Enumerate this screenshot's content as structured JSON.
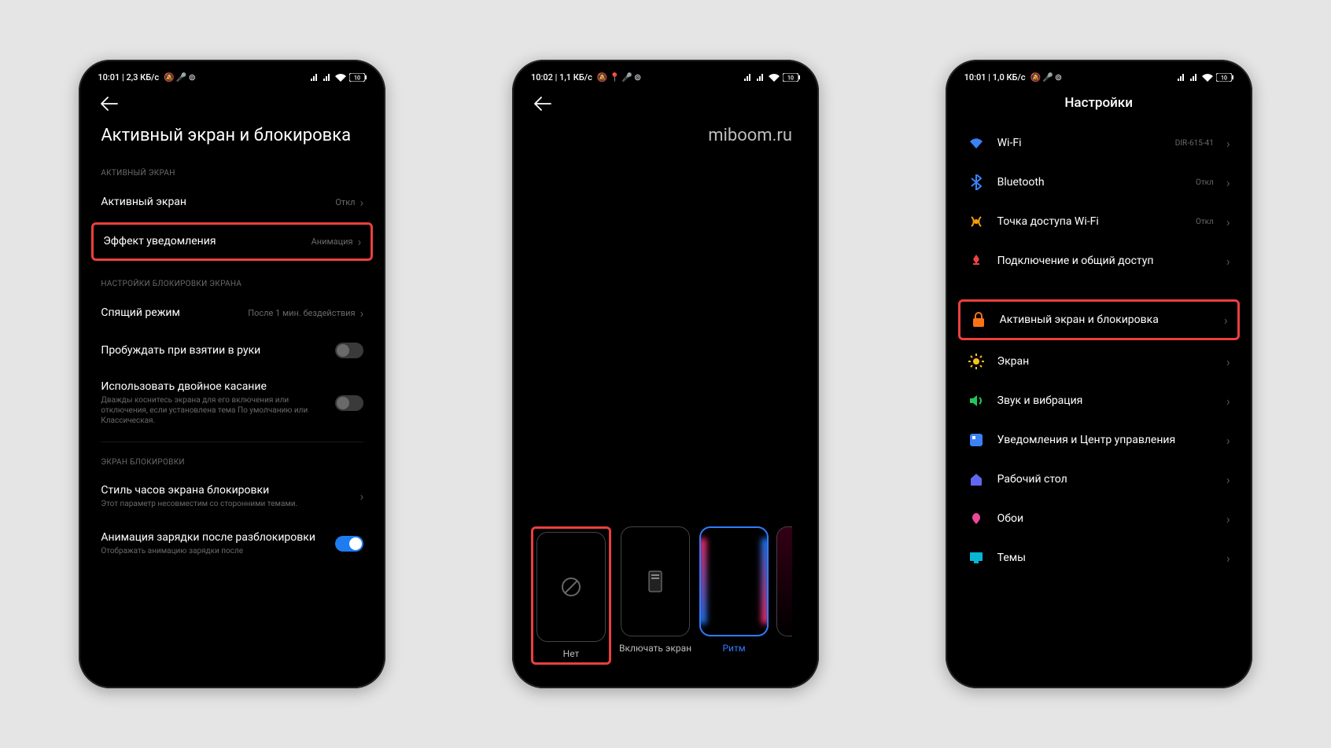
{
  "watermark": "miboom.ru",
  "phone1": {
    "status": {
      "left": "10:01 | 2,3 КБ/с"
    },
    "title": "Активный экран и блокировка",
    "section1": "АКТИВНЫЙ ЭКРАН",
    "row_active": {
      "label": "Активный экран",
      "value": "Откл"
    },
    "row_effect": {
      "label": "Эффект уведомления",
      "value": "Анимация"
    },
    "section2": "НАСТРОЙКИ БЛОКИРОВКИ ЭКРАНА",
    "row_sleep": {
      "label": "Спящий режим",
      "value": "После 1 мин. бездействия"
    },
    "row_raise": {
      "label": "Пробуждать при взятии в руки"
    },
    "row_doubletap": {
      "label": "Использовать двойное касание",
      "sub": "Дважды коснитесь экрана для его включения или отключения, если установлена тема По умолчанию или Классическая."
    },
    "section3": "ЭКРАН БЛОКИРОВКИ",
    "row_clock": {
      "label": "Стиль часов экрана блокировки",
      "sub": "Этот параметр несовместим со сторонними темами."
    },
    "row_charge": {
      "label": "Анимация зарядки после разблокировки",
      "sub": "Отображать анимацию зарядки после"
    }
  },
  "phone2": {
    "status": {
      "left": "10:02 | 1,1 КБ/с"
    },
    "effects": [
      {
        "label": "Нет"
      },
      {
        "label": "Включать экран"
      },
      {
        "label": "Ритм"
      }
    ]
  },
  "phone3": {
    "status": {
      "left": "10:01 | 1,0 КБ/с"
    },
    "title": "Настройки",
    "items": {
      "wifi": {
        "label": "Wi-Fi",
        "value": "DIR-615-41"
      },
      "bt": {
        "label": "Bluetooth",
        "value": "Откл"
      },
      "hotspot": {
        "label": "Точка доступа Wi-Fi",
        "value": "Откл"
      },
      "share": {
        "label": "Подключение и общий доступ"
      },
      "lock": {
        "label": "Активный экран и блокировка"
      },
      "display": {
        "label": "Экран"
      },
      "sound": {
        "label": "Звук и вибрация"
      },
      "notif": {
        "label": "Уведомления и Центр управления"
      },
      "home": {
        "label": "Рабочий стол"
      },
      "wallpaper": {
        "label": "Обои"
      },
      "themes": {
        "label": "Темы"
      }
    }
  }
}
